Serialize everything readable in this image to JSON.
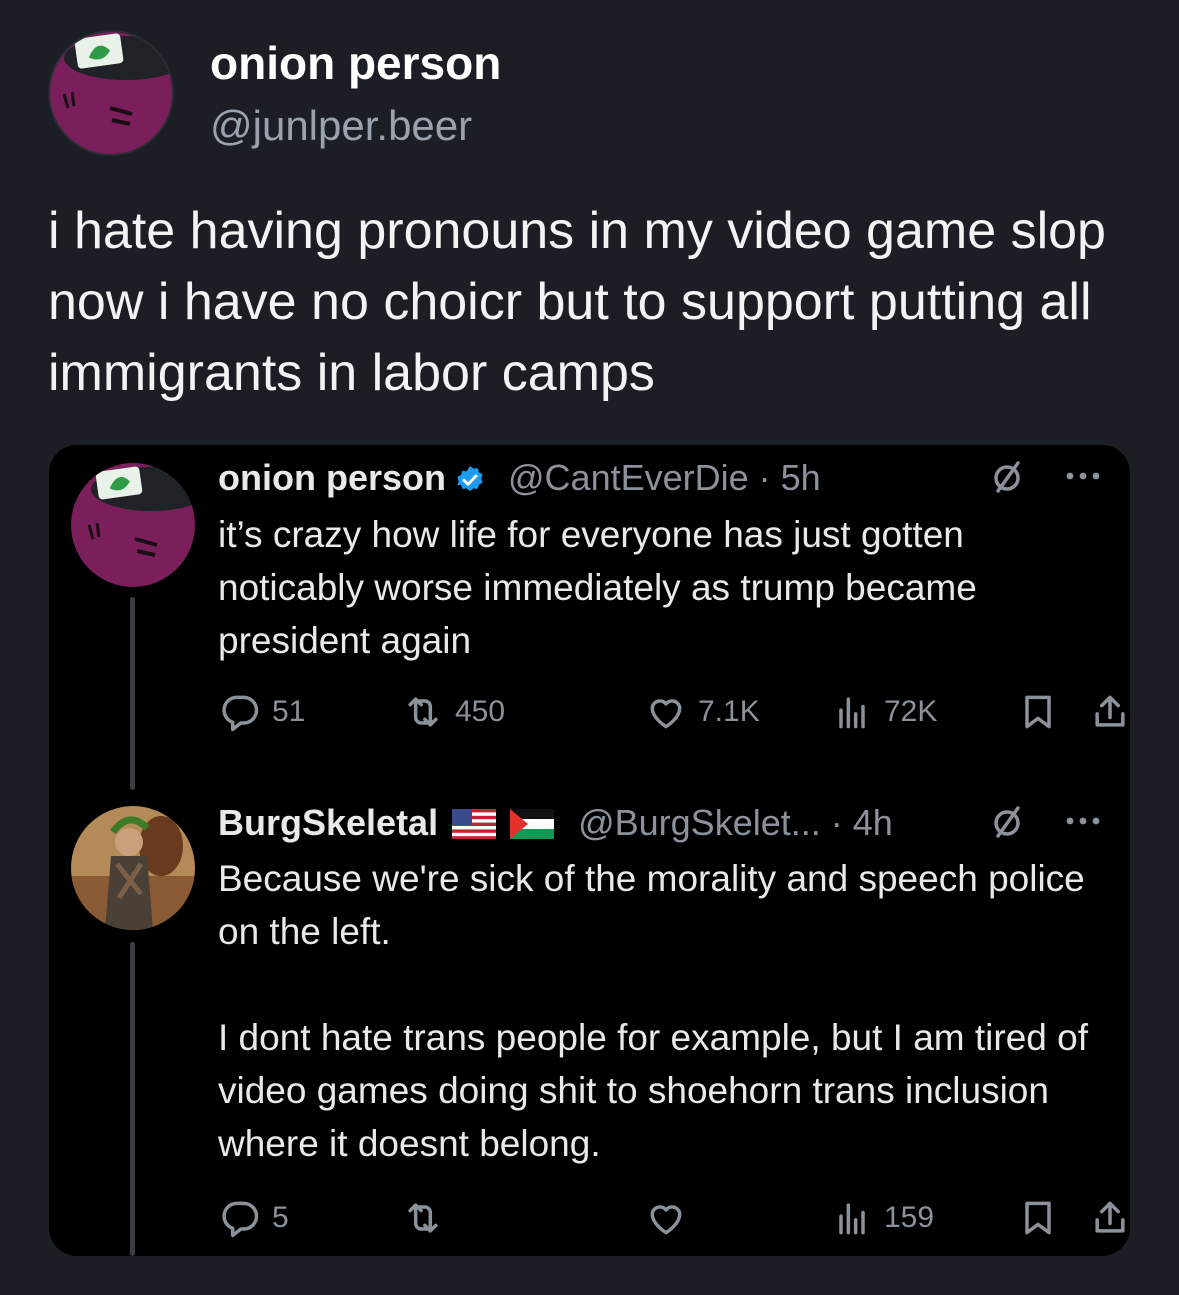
{
  "post": {
    "author_name": "onion person",
    "author_handle": "@junlper.beer",
    "text": "i hate having pronouns in my video game slop now i have no choicr but to support putting all immigrants in labor camps"
  },
  "embed": {
    "tweets": [
      {
        "name": "onion person",
        "handle": "@CantEverDie",
        "time": "· 5h",
        "verified": true,
        "body": [
          "it’s crazy how life for everyone has just gotten noticably worse immediately as trump became president again"
        ],
        "counts": {
          "replies": "51",
          "reposts": "450",
          "likes": "7.1K",
          "views": "72K"
        }
      },
      {
        "name": "BurgSkeletal",
        "handle": "@BurgSkelet...",
        "time": "· 4h",
        "flags": [
          "us-flag-icon",
          "palestine-flag-icon"
        ],
        "body": [
          "Because we're sick of the morality and speech police on the left.",
          "I dont hate trans people for example, but I am tired of video games doing shit to shoehorn trans inclusion where it doesnt belong."
        ],
        "counts": {
          "replies": "5",
          "reposts": "",
          "likes": "",
          "views": "159"
        }
      }
    ]
  },
  "colors": {
    "page_bg": "#1b1e24",
    "embed_bg": "#000000",
    "muted": "#8b9299",
    "verified": "#1d9bf0",
    "avatar_purple": "#7a1f5c"
  }
}
